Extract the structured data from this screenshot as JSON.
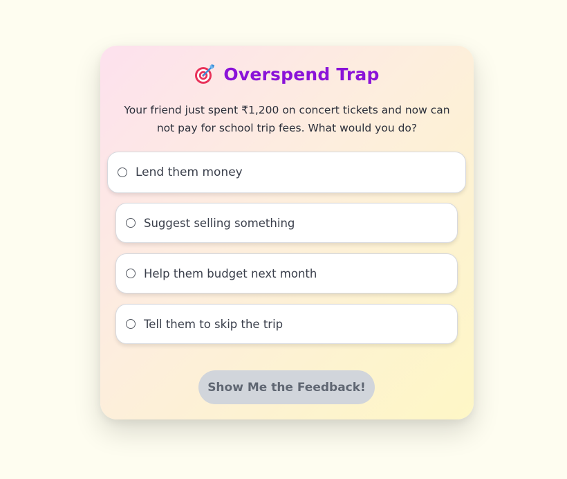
{
  "quiz": {
    "title": "Overspend Trap",
    "title_icon": "direct-hit-target-icon",
    "question": "Your friend just spent ₹1,200 on concert tickets and now can not pay for school trip fees. What would you do?",
    "options": [
      {
        "label": "Lend them money",
        "selected": false
      },
      {
        "label": "Suggest selling something",
        "selected": false
      },
      {
        "label": "Help them budget next month",
        "selected": false
      },
      {
        "label": "Tell them to skip the trip",
        "selected": false
      }
    ],
    "submit_label": "Show Me the Feedback!",
    "submit_enabled": false
  },
  "colors": {
    "page_background": "#fefdf0",
    "title": "#8a12d8",
    "question_text": "#2b2f3a",
    "option_text": "#3a3f4b",
    "button_disabled_bg": "#d1d5db",
    "button_disabled_text": "#5f6672",
    "target_red": "#e8325a",
    "dart_blue": "#3b8fd9"
  }
}
